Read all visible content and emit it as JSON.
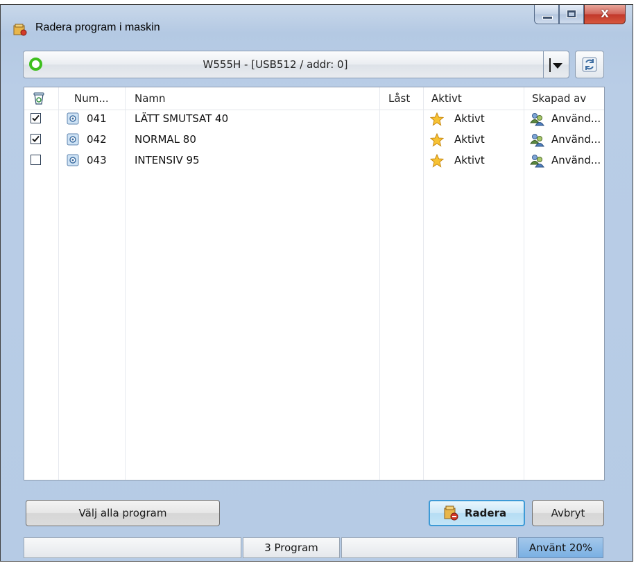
{
  "window": {
    "title": "Radera program i maskin",
    "close_label": "X"
  },
  "machine": {
    "name": "W555H - [USB512 / addr: 0]",
    "status_color": "#3fbf1e"
  },
  "columns": {
    "delete_icon": "recycle-bin-icon",
    "number": "Num...",
    "name": "Namn",
    "locked": "Låst",
    "active": "Aktivt",
    "created_by": "Skapad av"
  },
  "programs": [
    {
      "checked": true,
      "number": "041",
      "name": "LÄTT SMUTSAT 40",
      "locked": "",
      "active": "Aktivt",
      "created_by": "Använd..."
    },
    {
      "checked": true,
      "number": "042",
      "name": "NORMAL 80",
      "locked": "",
      "active": "Aktivt",
      "created_by": "Använd..."
    },
    {
      "checked": false,
      "number": "043",
      "name": "INTENSIV 95",
      "locked": "",
      "active": "Aktivt",
      "created_by": "Använd..."
    }
  ],
  "buttons": {
    "select_all": "Välj alla program",
    "delete": "Radera",
    "cancel": "Avbryt"
  },
  "statusbar": {
    "left": "",
    "count": "3 Program",
    "middle": "",
    "usage": "Använt 20%",
    "usage_percent": 20
  }
}
